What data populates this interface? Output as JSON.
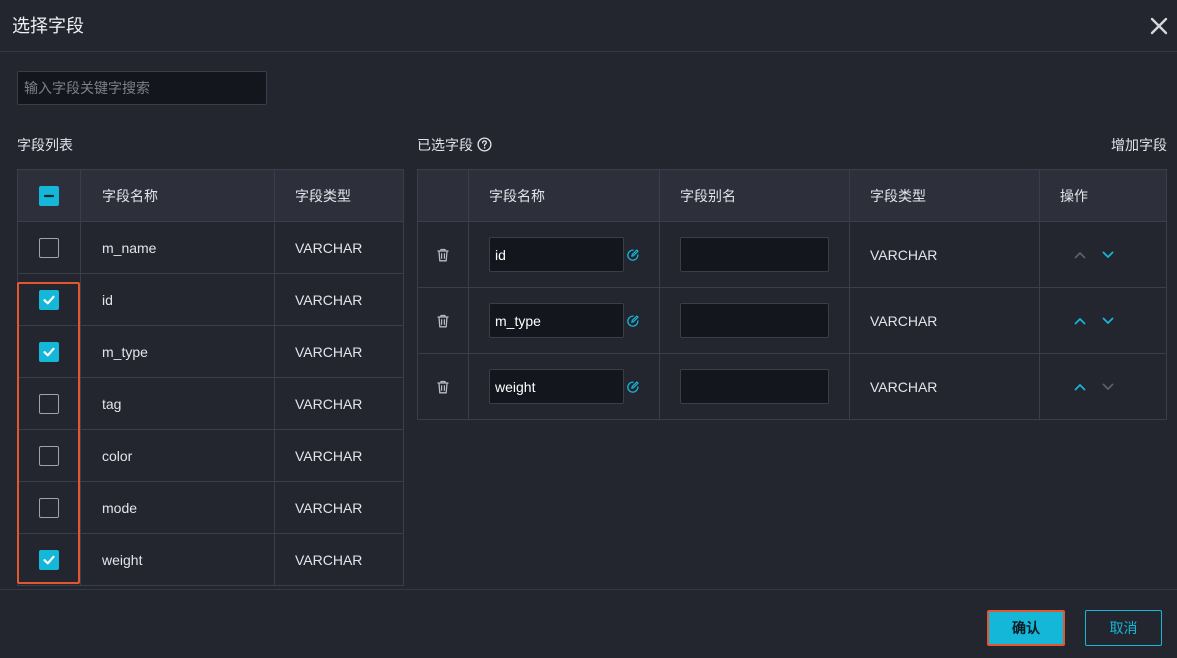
{
  "dialog": {
    "title": "选择字段",
    "search_placeholder": "输入字段关键字搜索",
    "confirm_label": "确认",
    "cancel_label": "取消"
  },
  "field_list": {
    "title": "字段列表",
    "header": {
      "name": "字段名称",
      "type": "字段类型"
    },
    "select_all_state": "indeterminate",
    "rows": [
      {
        "name": "m_name",
        "type": "VARCHAR",
        "checked": false
      },
      {
        "name": "id",
        "type": "VARCHAR",
        "checked": true
      },
      {
        "name": "m_type",
        "type": "VARCHAR",
        "checked": true
      },
      {
        "name": "tag",
        "type": "VARCHAR",
        "checked": false
      },
      {
        "name": "color",
        "type": "VARCHAR",
        "checked": false
      },
      {
        "name": "mode",
        "type": "VARCHAR",
        "checked": false
      },
      {
        "name": "weight",
        "type": "VARCHAR",
        "checked": true
      }
    ]
  },
  "selected_fields": {
    "title": "已选字段",
    "add_label": "增加字段",
    "header": {
      "name": "字段名称",
      "alias": "字段别名",
      "type": "字段类型",
      "ops": "操作"
    },
    "rows": [
      {
        "name": "id",
        "alias": "",
        "type": "VARCHAR",
        "up_enabled": false,
        "down_enabled": true
      },
      {
        "name": "m_type",
        "alias": "",
        "type": "VARCHAR",
        "up_enabled": true,
        "down_enabled": true
      },
      {
        "name": "weight",
        "alias": "",
        "type": "VARCHAR",
        "up_enabled": true,
        "down_enabled": false
      }
    ]
  },
  "colors": {
    "accent": "#14b7d8",
    "highlight": "#e2572f",
    "background": "#23252f",
    "disabled": "#5b5f6b"
  },
  "icons": {
    "close": "close-icon",
    "help": "help-icon",
    "edit": "edit-icon",
    "delete": "trash-icon",
    "up": "chevron-up-icon",
    "down": "chevron-down-icon",
    "check": "check-icon",
    "minus": "minus-icon"
  }
}
